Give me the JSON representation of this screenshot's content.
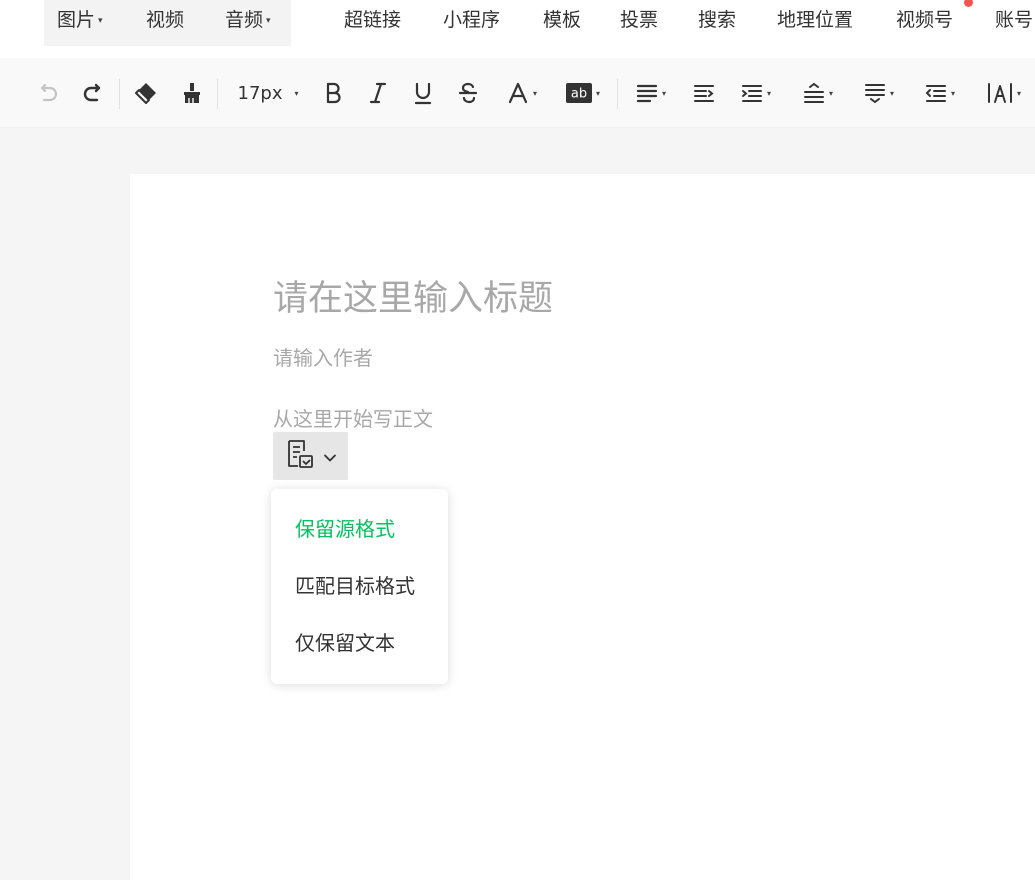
{
  "top_menu": {
    "items": [
      {
        "label": "图片",
        "has_dropdown": true
      },
      {
        "label": "视频",
        "has_dropdown": false
      },
      {
        "label": "音频",
        "has_dropdown": true
      },
      {
        "label": "超链接",
        "has_dropdown": false
      },
      {
        "label": "小程序",
        "has_dropdown": false
      },
      {
        "label": "模板",
        "has_dropdown": false
      },
      {
        "label": "投票",
        "has_dropdown": false
      },
      {
        "label": "搜索",
        "has_dropdown": false
      },
      {
        "label": "地理位置",
        "has_dropdown": false
      },
      {
        "label": "视频号",
        "has_dropdown": false
      },
      {
        "label": "账号",
        "has_dropdown": false
      }
    ],
    "caret": "▾",
    "notification_color": "#fa5151"
  },
  "toolbar": {
    "font_size": "17px",
    "caret": "▾",
    "tools": [
      "undo-icon",
      "redo-icon",
      "clear-format-icon",
      "format-painter-icon",
      "bold-icon",
      "italic-icon",
      "underline-icon",
      "strikethrough-icon",
      "font-color-icon",
      "background-color-icon",
      "align-icon",
      "indent-icon",
      "justify-icon",
      "line-height-icon",
      "paragraph-spacing-icon",
      "list-indent-icon",
      "letter-spacing-icon"
    ]
  },
  "editor": {
    "title_placeholder": "请在这里输入标题",
    "author_placeholder": "请输入作者",
    "body_placeholder": "从这里开始写正文"
  },
  "paste_menu": {
    "options": [
      {
        "label": "保留源格式",
        "active": true
      },
      {
        "label": "匹配目标格式",
        "active": false
      },
      {
        "label": "仅保留文本",
        "active": false
      }
    ],
    "active_color": "#07c160"
  }
}
